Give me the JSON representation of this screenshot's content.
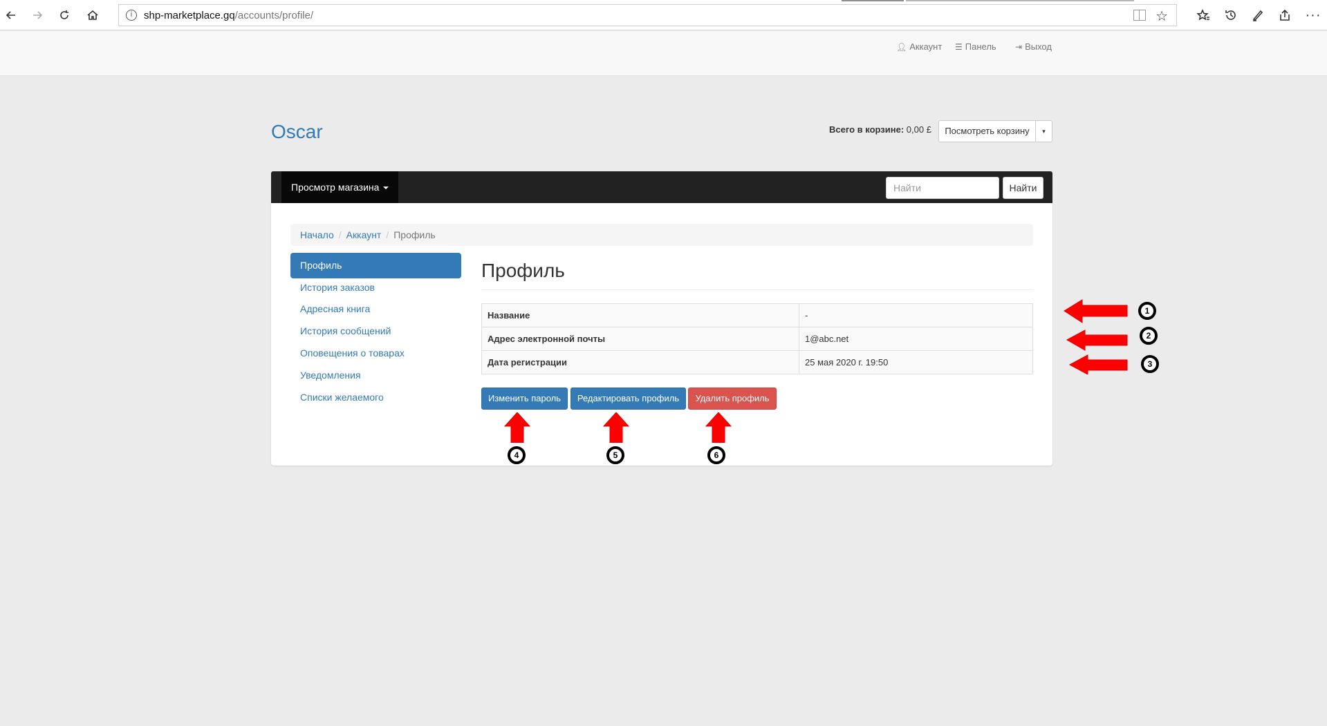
{
  "browser": {
    "url_host": "shp-marketplace.gq",
    "url_path": "/accounts/profile/"
  },
  "user_nav": {
    "account": "Аккаунт",
    "dashboard": "Панель",
    "logout": "Выход"
  },
  "header": {
    "brand": "Oscar",
    "basket_total_label": "Всего в корзине:",
    "basket_total_value": "0,00 £",
    "view_basket": "Посмотреть корзину"
  },
  "navbar": {
    "browse_store": "Просмотр магазина",
    "search_placeholder": "Найти",
    "search_button": "Найти"
  },
  "breadcrumb": {
    "home": "Начало",
    "account": "Аккаунт",
    "current": "Профиль"
  },
  "sidebar": {
    "items": [
      {
        "label": "Профиль",
        "active": true
      },
      {
        "label": "История заказов",
        "active": false
      },
      {
        "label": "Адресная книга",
        "active": false
      },
      {
        "label": "История сообщений",
        "active": false
      },
      {
        "label": "Оповещения о товарах",
        "active": false
      },
      {
        "label": "Уведомления",
        "active": false
      },
      {
        "label": "Списки желаемого",
        "active": false
      }
    ]
  },
  "profile": {
    "title": "Профиль",
    "rows": [
      {
        "key": "Название",
        "value": "-"
      },
      {
        "key": "Адрес электронной почты",
        "value": "1@abc.net"
      },
      {
        "key": "Дата регистрации",
        "value": "25 мая 2020 г. 19:50"
      }
    ],
    "buttons": {
      "change_password": "Изменить пароль",
      "edit_profile": "Редактировать профиль",
      "delete_profile": "Удалить профиль"
    }
  },
  "annotations": {
    "arrow_color": "#ff0000",
    "badges": [
      "1",
      "2",
      "3",
      "4",
      "5",
      "6"
    ]
  },
  "colors": {
    "link": "#337ab7",
    "primary": "#337ab7",
    "danger": "#d9534f",
    "navbar": "#222222"
  }
}
